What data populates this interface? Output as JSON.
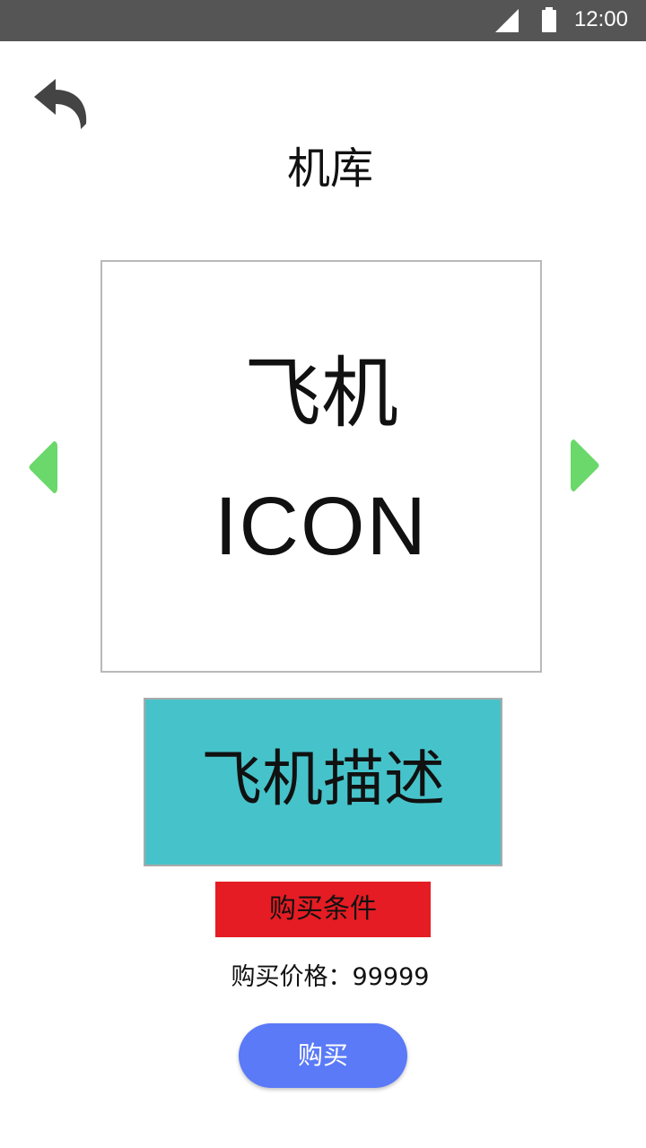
{
  "status_bar": {
    "time": "12:00",
    "signal_icon": "signal-icon",
    "battery_icon": "battery-icon",
    "background": "#555555"
  },
  "header": {
    "back_icon": "back-arrow-icon",
    "title": "机库"
  },
  "carousel": {
    "icon_line1": "飞机",
    "icon_line2": "ICON",
    "prev_icon": "chevron-left-icon",
    "next_icon": "chevron-right-icon",
    "arrow_color": "#6ad86a"
  },
  "description": {
    "text": "飞机描述",
    "background": "#46c3ca"
  },
  "purchase": {
    "condition_label": "购买条件",
    "condition_color": "#e51c23",
    "price_label": "购买价格：",
    "price_value": "99999",
    "buy_label": "购买",
    "buy_color": "#5a7af7"
  }
}
